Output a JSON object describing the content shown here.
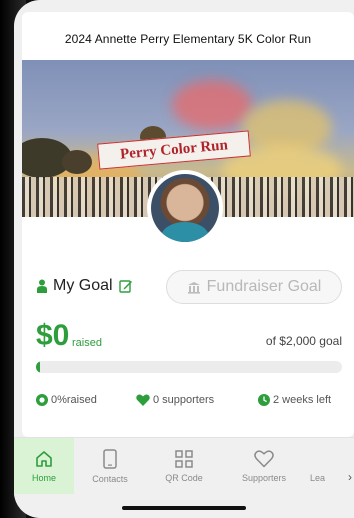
{
  "event": {
    "title": "2024 Annette Perry Elementary 5K Color Run",
    "banner_sign_text": "Perry Color Run"
  },
  "goal": {
    "my_goal_label": "My Goal",
    "fundraiser_goal_label": "Fundraiser Goal"
  },
  "raised": {
    "amount": "$0",
    "word": "raised",
    "goal_text": "of $2,000 goal",
    "progress_fraction": 0
  },
  "stats": {
    "percent": "0%raised",
    "supporters": "0 supporters",
    "time_left": "2 weeks left"
  },
  "nav": {
    "items": [
      {
        "label": "Home",
        "icon": "home-icon",
        "active": true
      },
      {
        "label": "Contacts",
        "icon": "phone-icon",
        "active": false
      },
      {
        "label": "QR Code",
        "icon": "qr-code-icon",
        "active": false
      },
      {
        "label": "Supporters",
        "icon": "heart-icon",
        "active": false
      },
      {
        "label": "Lea",
        "icon": "leaderboard-icon",
        "active": false
      }
    ],
    "more_glyph": "›"
  },
  "colors": {
    "accent": "#2e9e3d",
    "active_tab_bg": "#d9f3d4",
    "muted_text": "#8a8a8a"
  }
}
